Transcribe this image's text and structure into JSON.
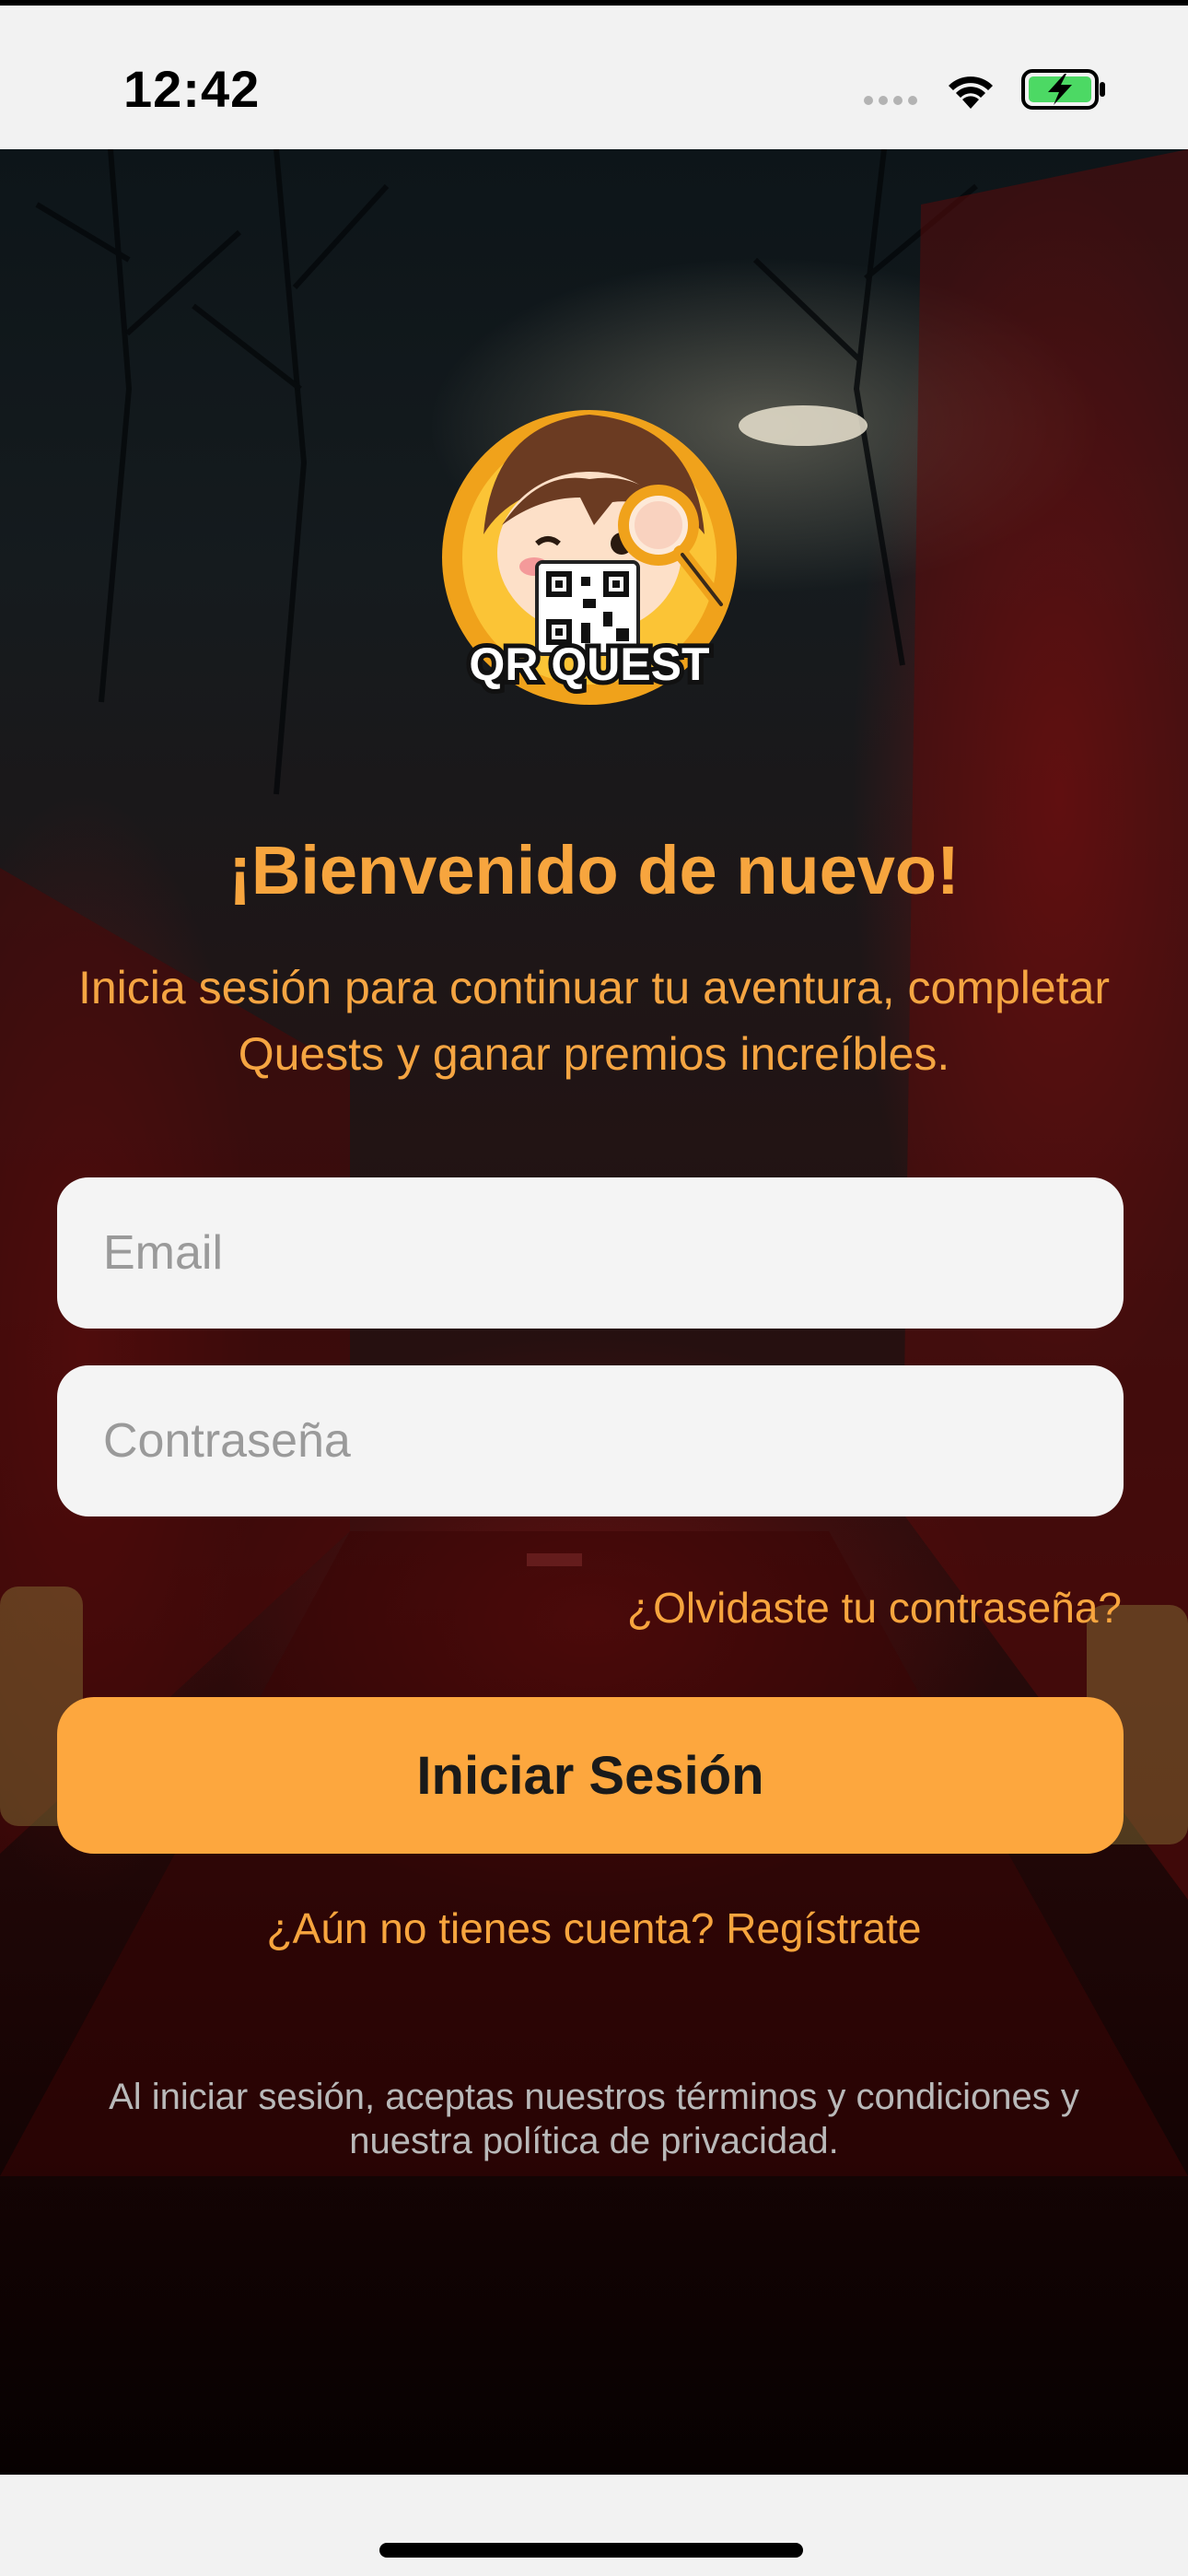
{
  "status_bar": {
    "time": "12:42",
    "icons": [
      "cellular-signal-icon",
      "wifi-icon",
      "battery-charging-icon"
    ],
    "battery_color": "#4cd964"
  },
  "logo": {
    "text": "QR QUEST",
    "description_icon": "qr-quest-mascot-logo"
  },
  "welcome": {
    "title": "¡Bienvenido de nuevo!",
    "subtitle": "Inicia sesión para continuar tu aventura, completar Quests y ganar premios increíbles."
  },
  "form": {
    "email_placeholder": "Email",
    "email_value": "",
    "password_placeholder": "Contraseña",
    "password_value": "",
    "forgot_password": "¿Olvidaste tu contraseña?",
    "login_button": "Iniciar Sesión",
    "register_link": "¿Aún no tienes cuenta? Regístrate"
  },
  "footer": {
    "terms": "Al iniciar sesión, aceptas nuestros términos y condiciones y nuestra política de privacidad."
  },
  "colors": {
    "accent": "#fda73e",
    "text_accent": "#f7a53e",
    "field_bg": "#f4f4f4",
    "terms_text": "#b9b9b9"
  }
}
